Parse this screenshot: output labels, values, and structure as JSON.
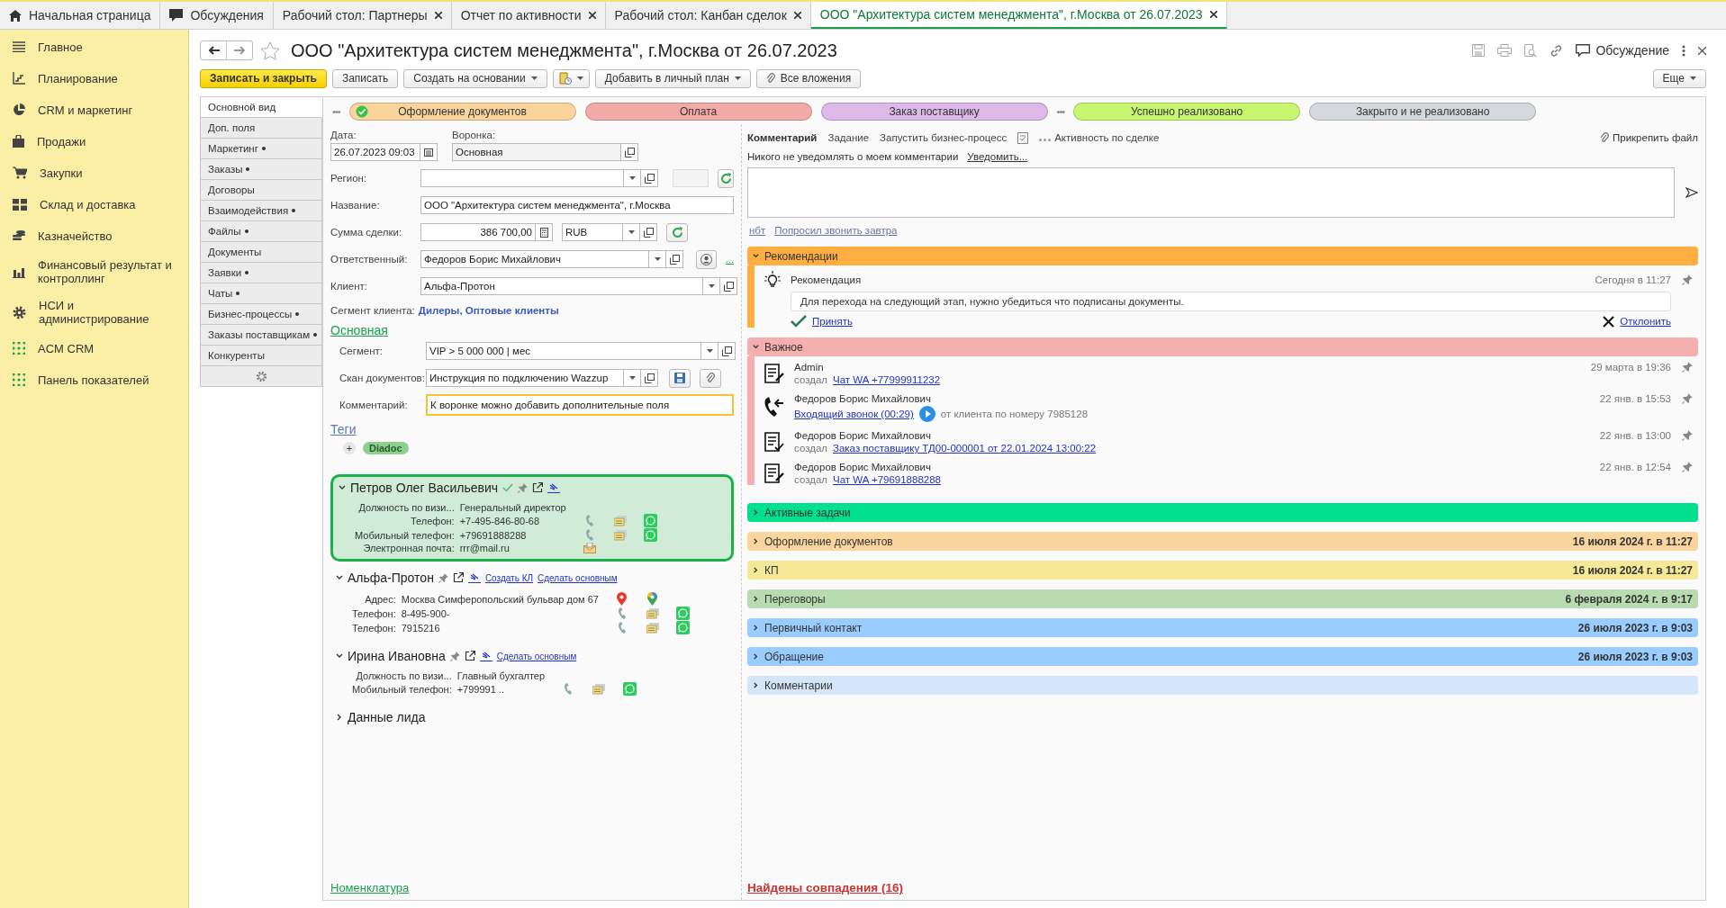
{
  "tabs": [
    {
      "label": "Начальная страница",
      "selected": false,
      "closable": false,
      "kind": "home"
    },
    {
      "label": "Обсуждения",
      "selected": false,
      "closable": false,
      "kind": "chat"
    },
    {
      "label": "Рабочий стол: Партнеры",
      "selected": false,
      "closable": true,
      "kind": "plain"
    },
    {
      "label": "Отчет по активности",
      "selected": false,
      "closable": true,
      "kind": "plain"
    },
    {
      "label": "Рабочий стол: Канбан сделок",
      "selected": false,
      "closable": true,
      "kind": "plain"
    },
    {
      "label": "ООО \"Архитектура систем менеджмента\", г.Москва от 26.07.2023",
      "selected": true,
      "closable": true,
      "kind": "plain"
    }
  ],
  "sidebar": {
    "items": [
      "Главное",
      "Планирование",
      "CRM и маркетинг",
      "Продажи",
      "Закупки",
      "Склад и доставка",
      "Казначейство",
      "Финансовый результат и контроллинг",
      "НСИ и администрирование",
      "ACM CRM",
      "Панель показателей"
    ]
  },
  "header": {
    "title": "ООО \"Архитектура систем менеджмента\", г.Москва от 26.07.2023",
    "discussion": "Обсуждение"
  },
  "toolbar": {
    "buttons": [
      {
        "label": "Записать и закрыть",
        "kind": "primary"
      },
      {
        "label": "Записать",
        "kind": "plain"
      },
      {
        "label": "Создать на основании",
        "kind": "menu"
      },
      {
        "kind": "icon_menu"
      },
      {
        "label": "Добавить в личный план",
        "kind": "menu"
      },
      {
        "label": "Все вложения",
        "kind": "attach"
      }
    ],
    "more": "Еще"
  },
  "form_tabs": [
    {
      "label": "Основной вид",
      "selected": true,
      "dot": false
    },
    {
      "label": "Доп. поля",
      "selected": false,
      "dot": false
    },
    {
      "label": "Маркетинг",
      "selected": false,
      "dot": true
    },
    {
      "label": "Заказы",
      "selected": false,
      "dot": true
    },
    {
      "label": "Договоры",
      "selected": false,
      "dot": false
    },
    {
      "label": "Взаимодействия",
      "selected": false,
      "dot": true
    },
    {
      "label": "Файлы",
      "selected": false,
      "dot": true
    },
    {
      "label": "Документы",
      "selected": false,
      "dot": false
    },
    {
      "label": "Заявки",
      "selected": false,
      "dot": true
    },
    {
      "label": "Чаты",
      "selected": false,
      "dot": true
    },
    {
      "label": "Бизнес-процессы",
      "selected": false,
      "dot": true
    },
    {
      "label": "Заказы поставщикам",
      "selected": false,
      "dot": true
    },
    {
      "label": "Конкуренты",
      "selected": false,
      "dot": false
    }
  ],
  "stages": [
    {
      "kind": "more",
      "label": "•••"
    },
    {
      "kind": "stage",
      "label": "Оформление документов",
      "color": "#f9d49c",
      "done": true
    },
    {
      "kind": "stage",
      "label": "Оплата",
      "color": "#f2aaa6",
      "done": false
    },
    {
      "kind": "stage",
      "label": "Заказ поставщику",
      "color": "#dcb9e8",
      "done": false
    },
    {
      "kind": "more",
      "label": "•••"
    },
    {
      "kind": "stage",
      "label": "Успешно реализовано",
      "color": "#c8f66e",
      "done": false
    },
    {
      "kind": "stage",
      "label": "Закрыто и не реализовано",
      "color": "#d5d9dd",
      "done": false
    }
  ],
  "form": {
    "date": {
      "label": "Дата:",
      "value": "26.07.2023 09:03"
    },
    "funnel": {
      "label": "Воронка:",
      "value": "Основная"
    },
    "region": {
      "label": "Регион:"
    },
    "name": {
      "label": "Название:",
      "value": "ООО \"Архитектура систем менеджмента\", г.Москва"
    },
    "amount": {
      "label": "Сумма сделки:",
      "value": "386 700,00",
      "currency": "RUB"
    },
    "responsible": {
      "label": "Ответственный:",
      "value": "Федоров Борис Михайлович",
      "more": "..."
    },
    "client": {
      "label": "Клиент:",
      "value": "Альфа-Протон"
    },
    "client_segment": {
      "label": "Сегмент клиента:",
      "value": "Дилеры, Оптовые клиенты"
    },
    "section": "Основная",
    "segment": {
      "label": "Сегмент:",
      "value": "VIP > 5 000 000 | мес"
    },
    "scan": {
      "label": "Скан документов:",
      "value": "Инструкция по подключению Wazzup"
    },
    "comment": {
      "label": "Комментарий:",
      "value": "К воронке можно добавить дополнительные поля",
      "focused": true
    },
    "tags": {
      "title": "Теги",
      "add": "+",
      "items": [
        "Diadoc"
      ]
    }
  },
  "contacts": [
    {
      "name": "Петров Олег Васильевич",
      "highlighted": true,
      "verified": true,
      "expanded": true,
      "fields": [
        {
          "kind": "position",
          "label": "Должность по визи...",
          "value": "Генеральный директор"
        },
        {
          "kind": "phone",
          "label": "Телефон:",
          "value": "+7-495-846-80-68"
        },
        {
          "kind": "phone",
          "label": "Мобильный телефон:",
          "value": "+79691888288"
        },
        {
          "kind": "email",
          "label": "Электронная почта:",
          "value": "rrr@mail.ru"
        }
      ]
    },
    {
      "name": "Альфа-Протон",
      "highlighted": false,
      "verified": false,
      "expanded": true,
      "links": [
        "Создать КЛ",
        "Сделать основным"
      ],
      "fields": [
        {
          "kind": "address",
          "label": "Адрес:",
          "value": "Москва Симферопольский бульвар дом 67"
        },
        {
          "kind": "phone",
          "label": "Телефон:",
          "value": "8-495-900-"
        },
        {
          "kind": "phone",
          "label": "Телефон:",
          "value": "7915216"
        }
      ]
    },
    {
      "name": "Ирина Ивановна",
      "highlighted": false,
      "verified": false,
      "expanded": true,
      "links": [
        "Сделать основным"
      ],
      "fields": [
        {
          "kind": "position",
          "label": "Должность по визи...",
          "value": "Главный бухгалтер"
        },
        {
          "kind": "phone",
          "label": "Мобильный телефон:",
          "value": "+799991 .."
        }
      ]
    },
    {
      "name": "Данные лида",
      "highlighted": false,
      "verified": false,
      "expanded": false,
      "kind": "section"
    }
  ],
  "footer_link": "Номенклатура",
  "right": {
    "comment_tabs": [
      {
        "kind": "text",
        "label": "Комментарий",
        "selected": true
      },
      {
        "kind": "text",
        "label": "Задание",
        "selected": false
      },
      {
        "kind": "text",
        "label": "Запустить бизнес-процесс",
        "selected": false
      },
      {
        "kind": "icon",
        "selected": false
      },
      {
        "kind": "dots",
        "label": "Активность по сделке",
        "selected": false
      }
    ],
    "attach": "Прикрепить файл",
    "notify": {
      "text": "Никого не уведомлять о моем комментарии",
      "link": "Уведомить..."
    },
    "quick_replies": [
      "нбт",
      "Попросил звонить завтра"
    ],
    "groups": [
      {
        "kind": "recommendation",
        "title": "Рекомендации",
        "color": "#ffae42",
        "expanded": true,
        "item": {
          "title": "Рекомендация",
          "time": "Сегодня в 11:27",
          "text": "Для перехода на следующий этап, нужно убедиться что подписаны документы.",
          "accept": "Принять",
          "reject": "Отклонить"
        }
      },
      {
        "kind": "events",
        "title": "Важное",
        "color": "#f4afae",
        "expanded": true,
        "events": [
          {
            "kind": "doc",
            "author": "Admin",
            "time": "29 марта в 19:36",
            "prefix": "создал",
            "link": "Чат WA +77999911232"
          },
          {
            "kind": "call",
            "author": "Федоров Борис Михайлович",
            "time": "22 янв. в 15:53",
            "link": "Входящий звонок (00:29)",
            "suffix": "от клиента по номеру 7985128"
          },
          {
            "kind": "doc_check",
            "author": "Федоров Борис Михайлович",
            "time": "22 янв. в 13:00",
            "prefix": "создал",
            "link": "Заказ поставщику ТД00-000001 от 22.01.2024 13:00:22"
          },
          {
            "kind": "doc",
            "author": "Федоров Борис Михайлович",
            "time": "22 янв. в 12:54",
            "prefix": "создал",
            "link": "Чат WA +79691888288"
          }
        ]
      },
      {
        "kind": "plain",
        "title": "Активные задачи",
        "color": "#00e08f",
        "expanded": false
      },
      {
        "kind": "plain",
        "title": "Оформление документов",
        "color": "#fad59e",
        "expanded": false,
        "date": "16 июля 2024 г. в 11:27"
      },
      {
        "kind": "plain",
        "title": "КП",
        "color": "#f5e896",
        "expanded": false,
        "date": "16 июля 2024 г. в 11:27"
      },
      {
        "kind": "plain",
        "title": "Переговоры",
        "color": "#b8dcb0",
        "expanded": false,
        "date": "6 февраля 2024 г. в 9:17"
      },
      {
        "kind": "plain",
        "title": "Первичный контакт",
        "color": "#99ccff",
        "expanded": false,
        "date": "26 июля 2023 г. в 9:03"
      },
      {
        "kind": "plain",
        "title": "Обращение",
        "color": "#99ccff",
        "expanded": false,
        "date": "26 июля 2023 г. в 9:03"
      },
      {
        "kind": "plain",
        "title": "Комментарии",
        "color": "#d5e6fb",
        "expanded": false
      }
    ],
    "matches": "Найдены совпадения (16)"
  }
}
